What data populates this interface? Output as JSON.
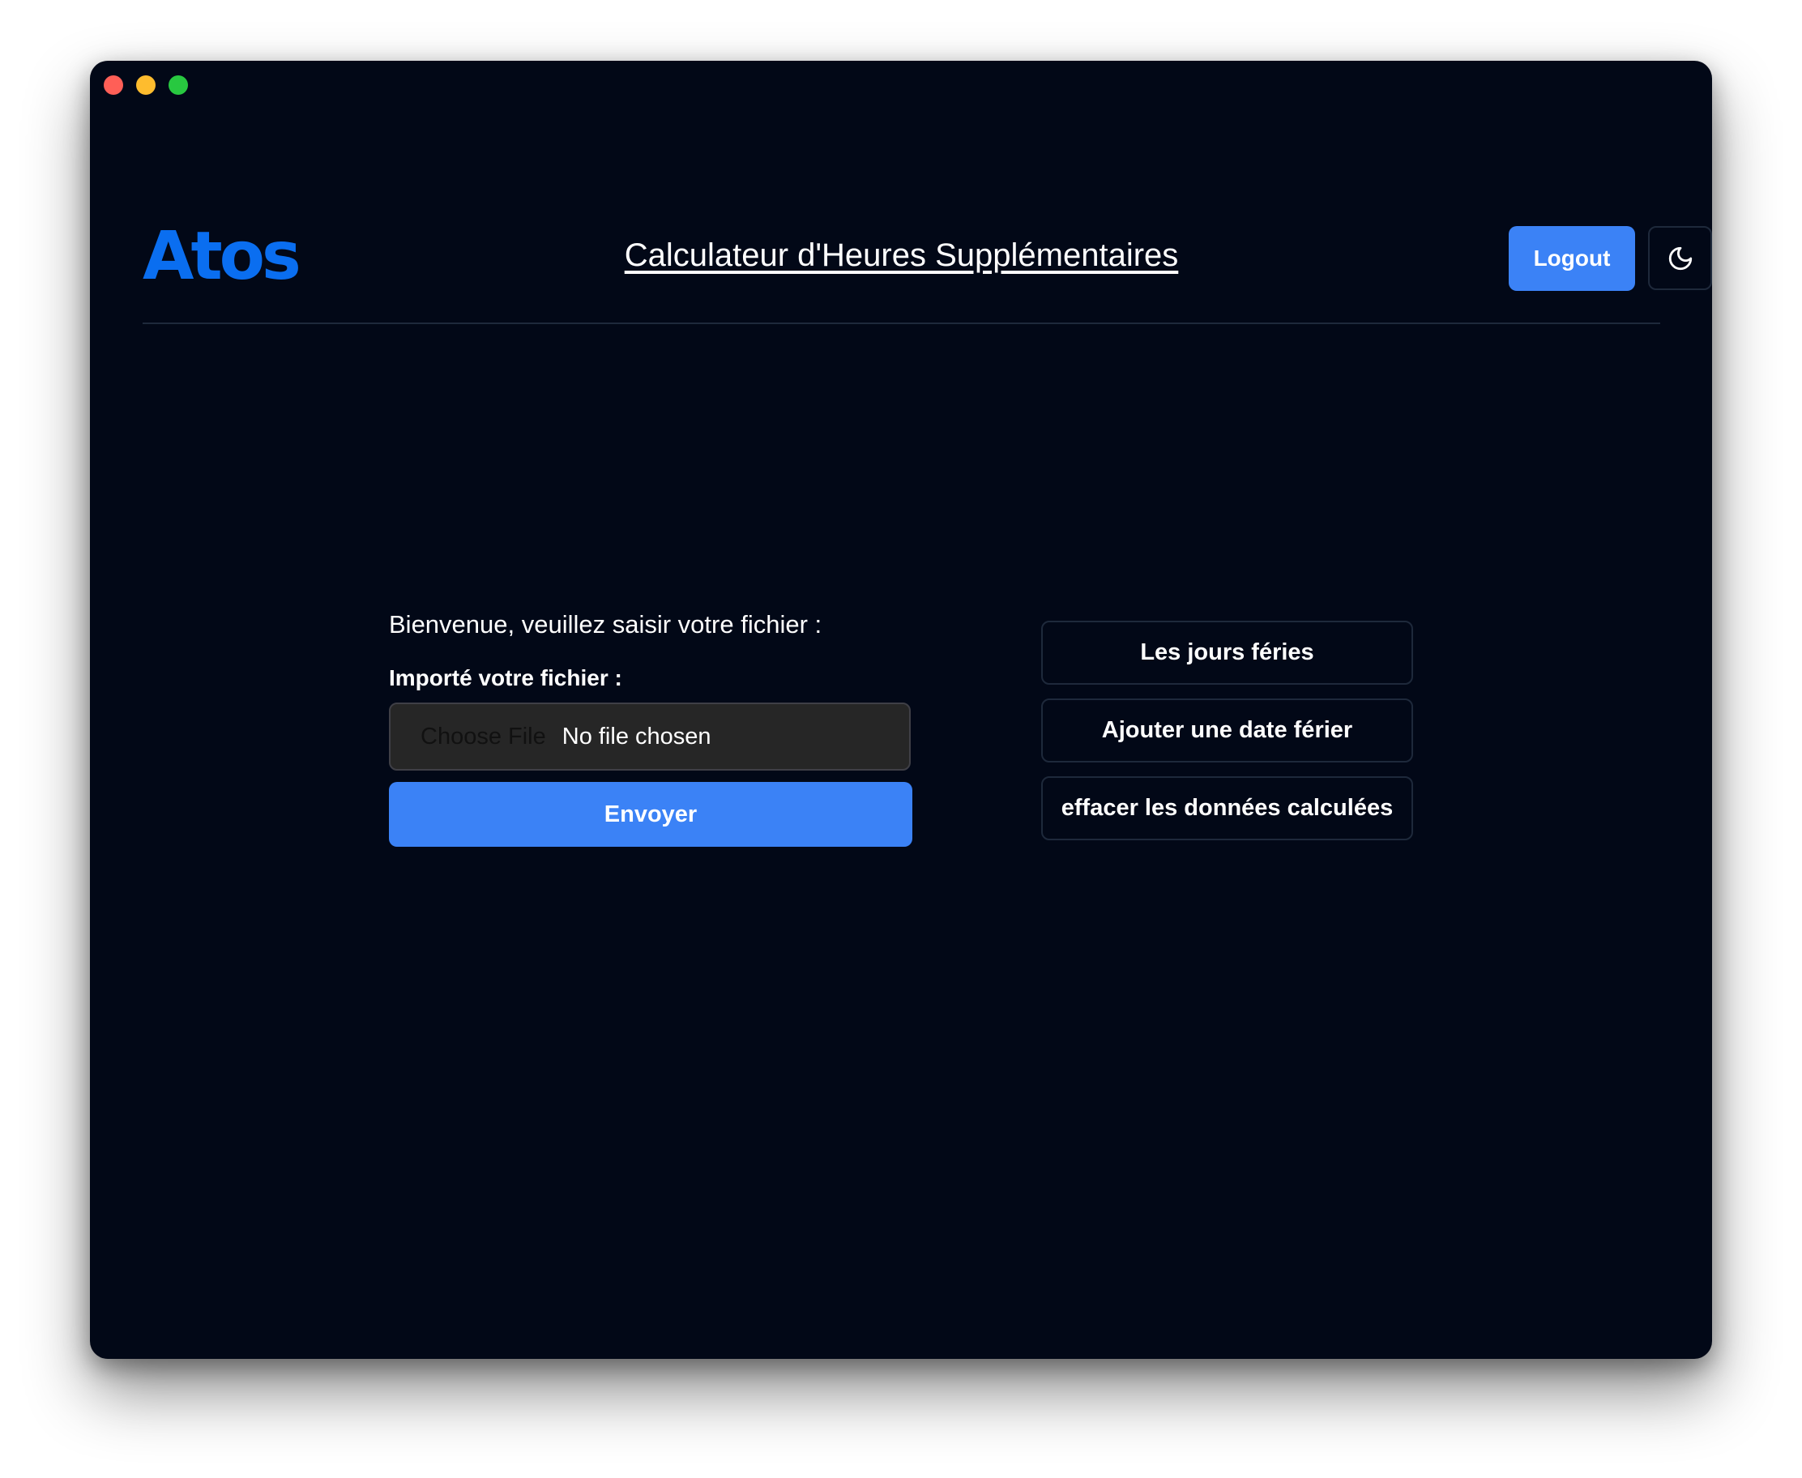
{
  "header": {
    "logo_text": "Atos",
    "title": "Calculateur d'Heures Supplémentaires",
    "logout_label": "Logout",
    "theme_toggle_icon": "moon-icon"
  },
  "upload": {
    "welcome": "Bienvenue, veuillez saisir votre fichier :",
    "file_label": "Importé votre fichier :",
    "choose_file_label": "Choose File",
    "no_file_text": "No file chosen",
    "submit_label": "Envoyer"
  },
  "actions": [
    {
      "label": "Les jours féries"
    },
    {
      "label": "Ajouter une date férier"
    },
    {
      "label": "effacer les données calculées"
    }
  ],
  "colors": {
    "background": "#020817",
    "primary": "#3b82f6",
    "brand": "#0a6ef0",
    "border": "#1e293b"
  }
}
